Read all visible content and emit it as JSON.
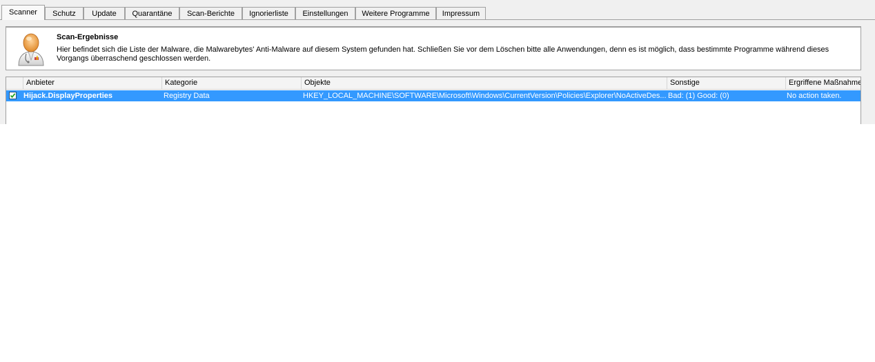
{
  "tabs": [
    {
      "label": "Scanner",
      "active": true
    },
    {
      "label": "Schutz"
    },
    {
      "label": "Update"
    },
    {
      "label": "Quarantäne"
    },
    {
      "label": "Scan-Berichte"
    },
    {
      "label": "Ignorierliste"
    },
    {
      "label": "Einstellungen"
    },
    {
      "label": "Weitere Programme"
    },
    {
      "label": "Impressum"
    }
  ],
  "results": {
    "title": "Scan-Ergebnisse",
    "description": "Hier befindet sich die Liste der Malware, die Malwarebytes' Anti-Malware auf diesem System gefunden hat. Schließen Sie vor dem Löschen bitte alle Anwendungen, denn es ist möglich, dass bestimmte Programme während dieses Vorgangs überraschend geschlossen werden.",
    "icon": "doctor-icon"
  },
  "table": {
    "columns": [
      "Anbieter",
      "Kategorie",
      "Objekte",
      "Sonstige",
      "Ergriffene Maßnahme:"
    ],
    "rows": [
      {
        "checked": true,
        "vendor": "Hijack.DisplayProperties",
        "category": "Registry Data",
        "object": "HKEY_LOCAL_MACHINE\\SOFTWARE\\Microsoft\\Windows\\CurrentVersion\\Policies\\Explorer\\NoActiveDes...",
        "other": "Bad: (1) Good: (0)",
        "action": "No action taken."
      }
    ]
  },
  "colors": {
    "selection": "#3399ff",
    "window_bg": "#f0f0f0",
    "border": "#a0a0a0"
  }
}
